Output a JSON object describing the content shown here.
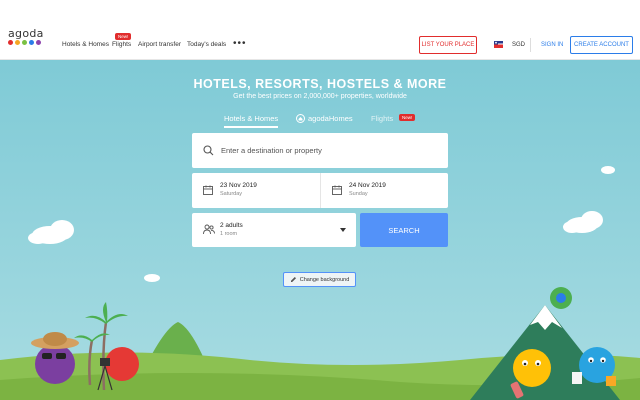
{
  "header": {
    "logo_text": "agoda",
    "logo_colors": [
      "#e12d2d",
      "#f5a623",
      "#7ac143",
      "#2b7de9",
      "#8e44ad"
    ],
    "nav": [
      {
        "label": "Hotels & Homes"
      },
      {
        "label": "Flights",
        "badge": "New!"
      },
      {
        "label": "Airport transfer"
      },
      {
        "label": "Today's deals"
      }
    ],
    "more_label": "•••",
    "list_place_label": "LIST YOUR PLACE",
    "currency": "SGD",
    "sign_in_label": "SIGN IN",
    "create_account_label": "CREATE ACCOUNT"
  },
  "hero": {
    "title": "HOTELS, RESORTS, HOSTELS & MORE",
    "subtitle": "Get the best prices on 2,000,000+ properties, worldwide",
    "tabs": [
      {
        "label": "Hotels & Homes",
        "active": true
      },
      {
        "label": "agodaHomes"
      },
      {
        "label": "Flights",
        "badge": "New!"
      }
    ]
  },
  "search": {
    "placeholder": "Enter a destination or property",
    "checkin_date": "23 Nov 2019",
    "checkin_day": "Saturday",
    "checkout_date": "24 Nov 2019",
    "checkout_day": "Sunday",
    "guests": "2 adults",
    "rooms": "1 room",
    "search_label": "SEARCH"
  },
  "change_background_label": "Change background",
  "colors": {
    "accent": "#5392f9",
    "brand_red": "#e12d2d",
    "sky": "#80cdd7"
  }
}
